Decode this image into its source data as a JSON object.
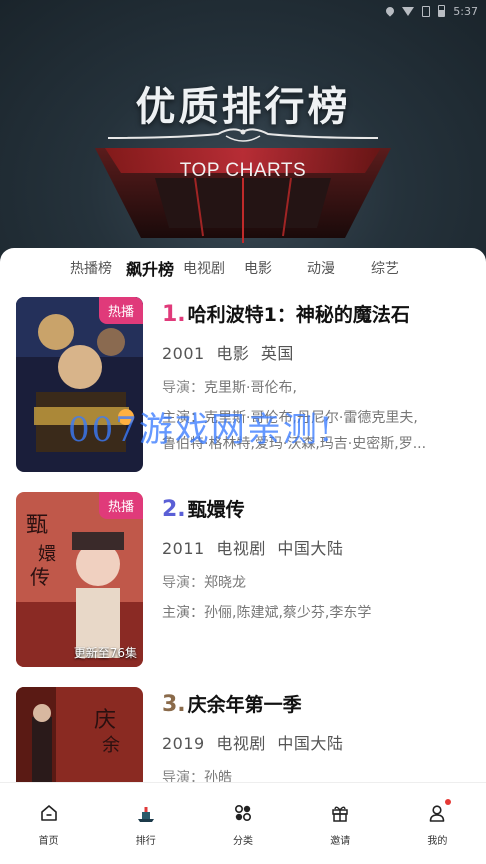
{
  "status_bar": {
    "time": "5:37"
  },
  "banner": {
    "title": "优质排行榜",
    "subtitle": "TOP CHARTS"
  },
  "tabs": [
    {
      "label": "热播榜",
      "active": false
    },
    {
      "label": "飙升榜",
      "active": true
    },
    {
      "label": "电视剧",
      "active": false
    },
    {
      "label": "电影",
      "active": false
    },
    {
      "label": "动漫",
      "active": false
    },
    {
      "label": "综艺",
      "active": false
    }
  ],
  "items": [
    {
      "rank": "1.",
      "rank_color": "#e03a7a",
      "title": "哈利波特1：神秘的魔法石",
      "year": "2001",
      "category": "电影",
      "region": "英国",
      "badge": "热播",
      "episode": "",
      "director_label": "导演：",
      "director": "克里斯·哥伦布,",
      "cast_label": "主演：",
      "cast_line1": "克里斯·哥伦布,丹尼尔·雷德克里夫,",
      "cast_line2": "鲁伯特·格林特,爱玛·沃森,玛吉·史密斯,罗..."
    },
    {
      "rank": "2.",
      "rank_color": "#5a5fd6",
      "title": "甄嬛传",
      "year": "2011",
      "category": "电视剧",
      "region": "中国大陆",
      "badge": "热播",
      "episode": "更新至76集",
      "director_label": "导演：",
      "director": "郑晓龙",
      "cast_label": "主演：",
      "cast_line1": "孙俪,陈建斌,蔡少芬,李东学",
      "cast_line2": ""
    },
    {
      "rank": "3.",
      "rank_color": "#8a6a4a",
      "title": "庆余年第一季",
      "year": "2019",
      "category": "电视剧",
      "region": "中国大陆",
      "badge": "",
      "episode": "",
      "director_label": "导演：",
      "director": "孙皓",
      "cast_label": "",
      "cast_line1": "",
      "cast_line2": ""
    }
  ],
  "watermark": "007游戏网亲测!",
  "bottom_nav": [
    {
      "label": "首页",
      "icon": "home-icon"
    },
    {
      "label": "排行",
      "icon": "ranking-icon"
    },
    {
      "label": "分类",
      "icon": "category-icon"
    },
    {
      "label": "邀请",
      "icon": "gift-icon"
    },
    {
      "label": "我的",
      "icon": "profile-icon"
    }
  ]
}
